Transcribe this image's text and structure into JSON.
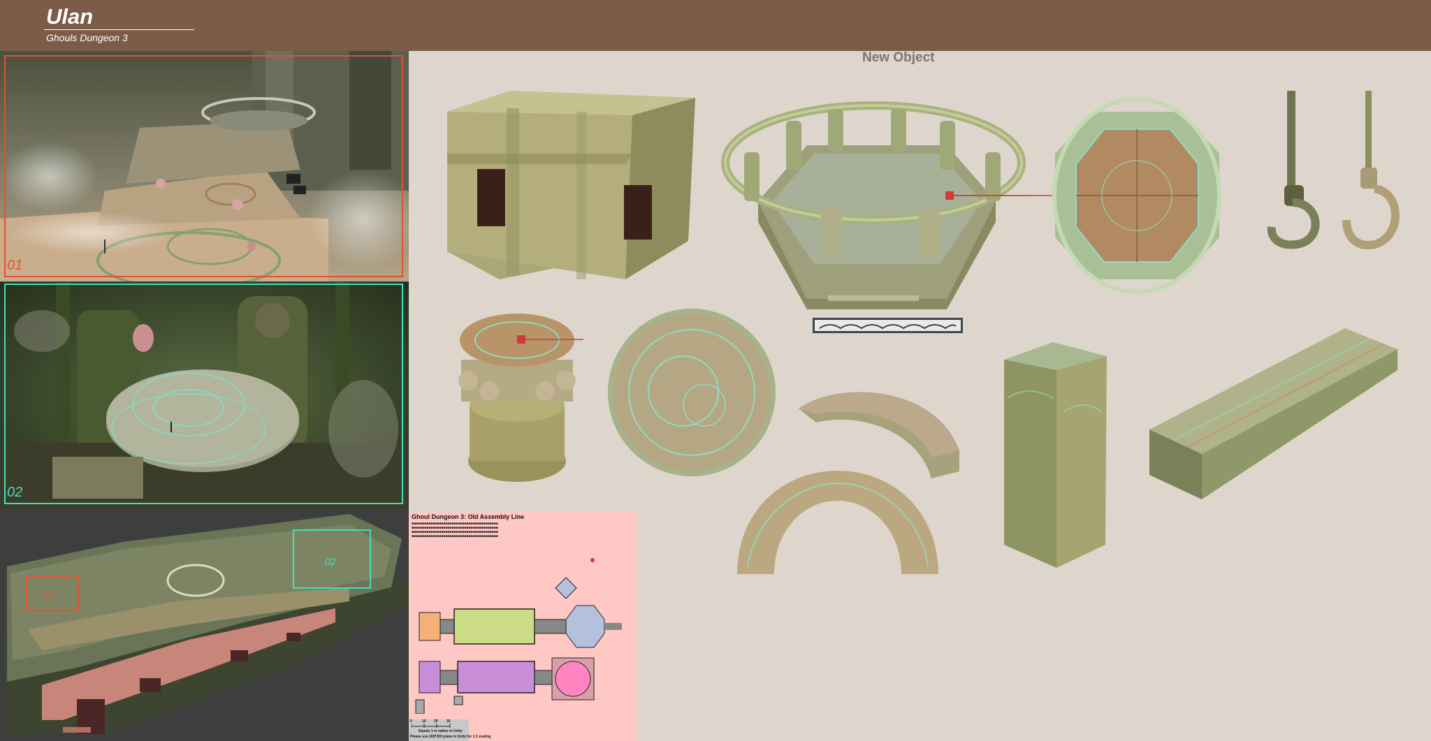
{
  "header": {
    "title": "Ulan",
    "subtitle": "Ghouls Dungeon 3"
  },
  "shots": [
    {
      "number": "01",
      "color": "#e0522e"
    },
    {
      "number": "02",
      "color": "#3fe0c0"
    }
  ],
  "overview": {
    "marker_1": "01",
    "marker_2": "02"
  },
  "section": {
    "title": "New Object"
  },
  "plan": {
    "title": "Ghoul Dungeon 3: Old Assembly Line",
    "scale_note": "Equals 1 m radius in Unity",
    "footer": "Please use 200*200 plane in Unity for 1:1 scaling",
    "scale_ticks": [
      "0",
      "10",
      "20",
      "30"
    ]
  },
  "colors": {
    "header_bg": "#7c5c48",
    "page_bg": "#ded6cc",
    "accent_red": "#d23a3a",
    "shot1_frame": "#e0522e",
    "shot2_frame": "#3fe0c0"
  }
}
